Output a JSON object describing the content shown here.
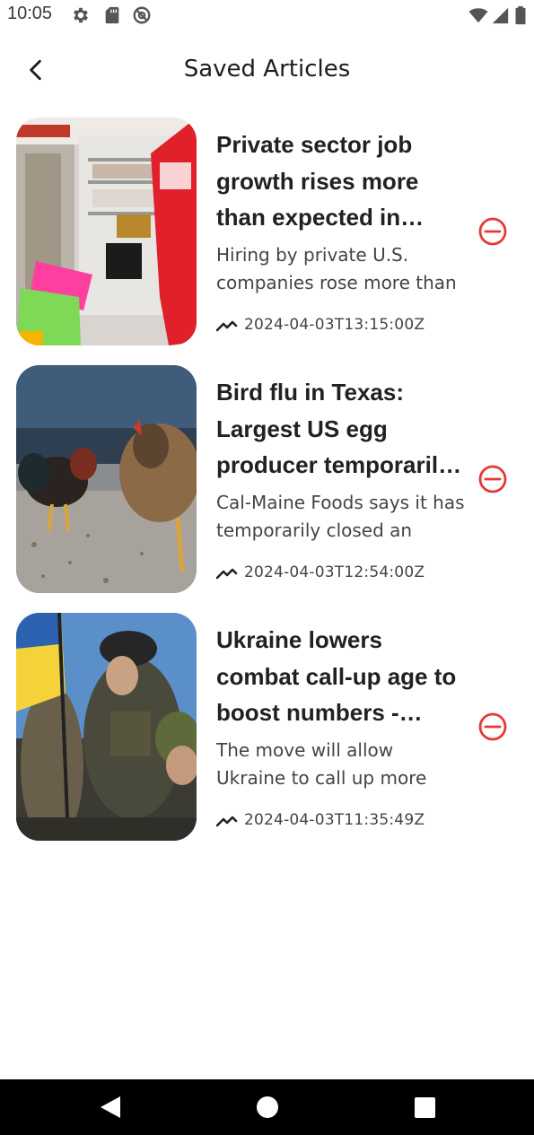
{
  "status_bar": {
    "time": "10:05",
    "left_icons": [
      "gear-icon",
      "sd-card-icon",
      "no-sync-icon"
    ],
    "right_icons": [
      "wifi-icon",
      "signal-icon",
      "battery-icon"
    ]
  },
  "header": {
    "title": "Saved Articles",
    "back_icon": "chevron-left-icon"
  },
  "articles": [
    {
      "title": "Private sector job growth rises more than expected in March",
      "description": "Hiring by private U.S. companies rose more than",
      "date": "2024-04-03T13:15:00Z",
      "image": "store-shelves-hiring-sign"
    },
    {
      "title": "Bird flu in Texas: Largest US egg producer temporarily halts production",
      "description": "Cal-Maine Foods says it has temporarily closed an",
      "date": "2024-04-03T12:54:00Z",
      "image": "roosters-on-gravel"
    },
    {
      "title": "Ukraine lowers combat call-up age to boost numbers - Reuters",
      "description": "The move will allow Ukraine to call up more",
      "date": "2024-04-03T11:35:49Z",
      "image": "soldiers-with-flag"
    }
  ],
  "colors": {
    "remove_red": "#e53935",
    "text_dark": "#212121",
    "text_muted": "#444444",
    "nav_bar": "#000000"
  },
  "nav_bar": {
    "buttons": [
      "back-triangle-icon",
      "home-circle-icon",
      "recents-square-icon"
    ]
  }
}
